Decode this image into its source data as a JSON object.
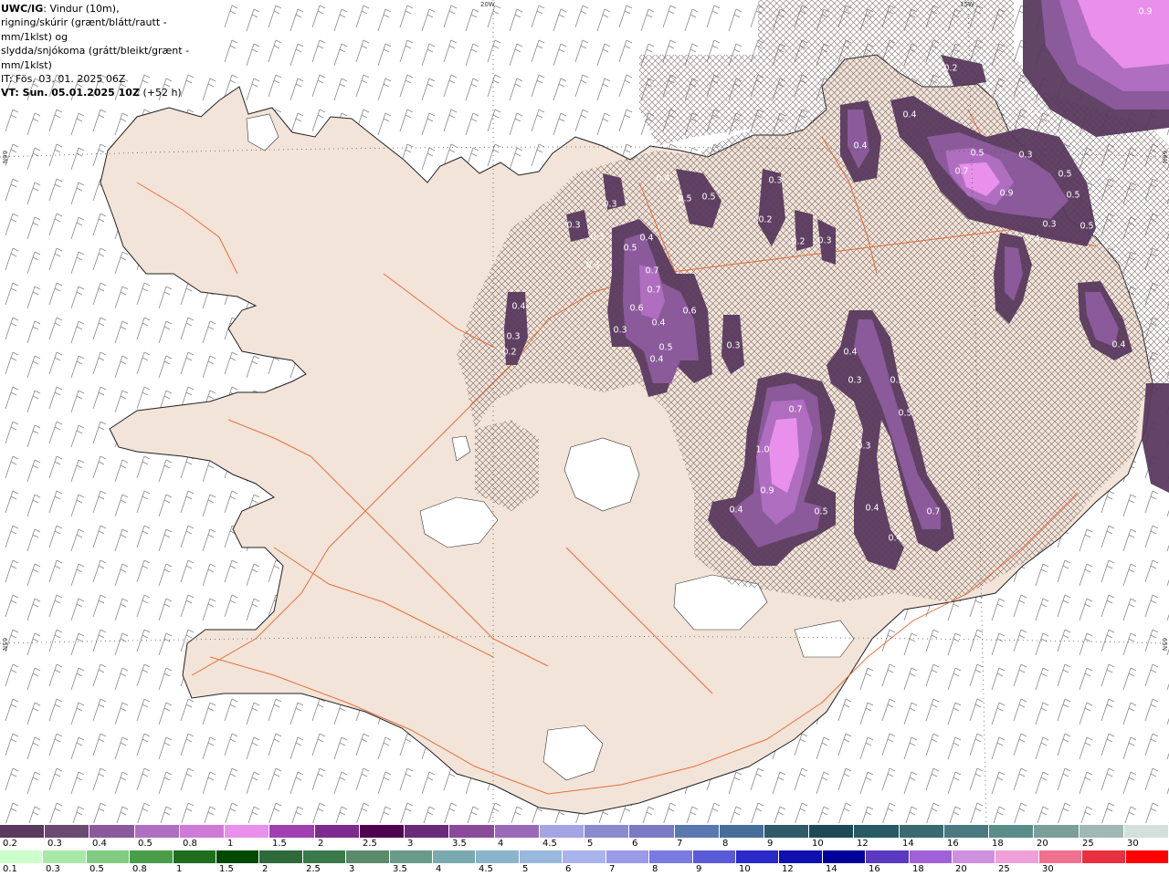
{
  "header": {
    "model": "UWC/IG",
    "line1": ": Vindur (10m),",
    "line2": "rigning/skúrir (grænt/blátt/rautt - mm/1klst) og",
    "line3": "slydda/snjókoma (grátt/bleikt/grænt - mm/1klst)",
    "it_label": "IT:",
    "it_value": "Fös. 03. 01. 2025 06Z",
    "vt_label": "VT: Sun. 05.01.2025 10Z",
    "vt_offset": "(+52 h)"
  },
  "grid_labels": {
    "lon_20w": "20W",
    "lon_15w": "15W",
    "lat_66n_left": "66N",
    "lat_65n_left": "65N",
    "lat_66n_right": "66N",
    "lat_65n_right": "65N"
  },
  "precip_values": [
    {
      "text": "0.9"
    },
    {
      "text": "0.2"
    },
    {
      "text": "0.4"
    },
    {
      "text": "0.2"
    },
    {
      "text": "0.4"
    },
    {
      "text": "0.5"
    },
    {
      "text": "0.3"
    },
    {
      "text": "0.7"
    },
    {
      "text": "0.5"
    },
    {
      "text": "0.5"
    },
    {
      "text": "0.5"
    },
    {
      "text": "0.3"
    },
    {
      "text": "0.3"
    },
    {
      "text": "0.4"
    },
    {
      "text": "0.9"
    },
    {
      "text": "0.3"
    },
    {
      "text": "0.5"
    },
    {
      "text": "0.5"
    },
    {
      "text": "0.2"
    },
    {
      "text": "0.2"
    },
    {
      "text": "0.3"
    },
    {
      "text": "0.3"
    },
    {
      "text": "0.3"
    },
    {
      "text": "0.3"
    },
    {
      "text": "0.5"
    },
    {
      "text": "0.4"
    },
    {
      "text": "0.4"
    },
    {
      "text": "0.7"
    },
    {
      "text": "0.7"
    },
    {
      "text": "0.6"
    },
    {
      "text": "0.6"
    },
    {
      "text": "0.3"
    },
    {
      "text": "0.4"
    },
    {
      "text": "0.5"
    },
    {
      "text": "0.3"
    },
    {
      "text": "0.4"
    },
    {
      "text": "0.3"
    },
    {
      "text": "0.4"
    },
    {
      "text": "0.2"
    },
    {
      "text": "0.4"
    },
    {
      "text": "0.3"
    },
    {
      "text": "0.5"
    },
    {
      "text": "0.7"
    },
    {
      "text": "0.5"
    },
    {
      "text": "1.0"
    },
    {
      "text": "0.3"
    },
    {
      "text": "0.9"
    },
    {
      "text": "0.4"
    },
    {
      "text": "0.5"
    },
    {
      "text": "0.4"
    },
    {
      "text": "0.7"
    },
    {
      "text": "0.4"
    },
    {
      "text": "0.4"
    }
  ],
  "legend": {
    "snow_colors": [
      "#5a3a5e",
      "#6b4a72",
      "#8a5a9a",
      "#b06ec0",
      "#d07ad8",
      "#e890ec",
      "#a040b0",
      "#7e2a8e",
      "#500050",
      "#6a2a7a",
      "#8a4a9a",
      "#9a6ab8",
      "#a4a4e4",
      "#8a8ad0",
      "#7a7ac4",
      "#5a78b0",
      "#466e98",
      "#2e5a6a",
      "#1e4a56",
      "#285a64",
      "#3a6a70",
      "#4a7a80",
      "#5a8c8a",
      "#7a9e9a",
      "#a0b8b4",
      "#d4e0dc"
    ],
    "snow_labels": [
      "0.2",
      "0.3",
      "0.4",
      "0.5",
      "0.8",
      "1",
      "1.5",
      "2",
      "2.5",
      "3",
      "3.5",
      "4",
      "4.5",
      "5",
      "6",
      "7",
      "8",
      "9",
      "10",
      "12",
      "14",
      "16",
      "18",
      "20",
      "25",
      "30"
    ],
    "rain_colors": [
      "#ccffcc",
      "#a8e8a8",
      "#80cc80",
      "#4a9e4a",
      "#1e6e1e",
      "#004a00",
      "#2e6a3a",
      "#3a7a4a",
      "#5a8a6a",
      "#6a9a8a",
      "#7aaab0",
      "#8ab4cc",
      "#9ab8dc",
      "#aab4ec",
      "#9a9ae8",
      "#7a7ae0",
      "#5a5ad8",
      "#2a2ac8",
      "#1010b0",
      "#00009a",
      "#5a3ac0",
      "#a060d8",
      "#d090e0",
      "#f0a0d8",
      "#f07090",
      "#e83040",
      "#ff0000"
    ],
    "rain_labels": [
      "0.1",
      "0.3",
      "0.5",
      "0.8",
      "1",
      "1.5",
      "2",
      "2.5",
      "3",
      "3.5",
      "4",
      "4.5",
      "5",
      "6",
      "7",
      "8",
      "9",
      "10",
      "12",
      "14",
      "16",
      "18",
      "20",
      "25",
      "30"
    ]
  },
  "colors": {
    "land": "#f2e4d8",
    "roads": "#e8622a",
    "coast": "#222222",
    "snow_light": "#8a5a9a",
    "snow_mid": "#b06ec0",
    "snow_heavy": "#e890ec",
    "snow_dark": "#5a3a5e",
    "wind_barb": "#777777"
  }
}
